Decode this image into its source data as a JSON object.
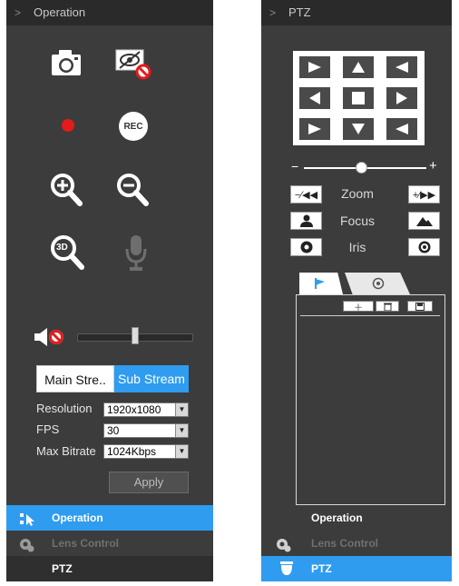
{
  "left_panel": {
    "header": "Operation",
    "icons": [
      "snapshot-camera-icon",
      "privacy-mask-off-icon",
      "record-dot-icon",
      "rec-button-icon",
      "zoom-in-icon",
      "zoom-out-icon",
      "3d-zoom-icon",
      "microphone-icon"
    ],
    "rec_label": "REC",
    "three_d_label": "3D",
    "volume_level": 0.5,
    "stream_tabs": [
      "Main Stre..",
      "Sub Stream"
    ],
    "selected_stream": "Sub Stream",
    "resolution_label": "Resolution",
    "resolution_value": "1920x1080",
    "fps_label": "FPS",
    "fps_value": "30",
    "bitrate_label": "Max Bitrate",
    "bitrate_value": "1024Kbps",
    "apply_label": "Apply",
    "nav": {
      "operation": "Operation",
      "lens": "Lens Control",
      "ptz": "PTZ"
    }
  },
  "right_panel": {
    "header": "PTZ",
    "zoom_label": "Zoom",
    "focus_label": "Focus",
    "iris_label": "Iris",
    "minus": "−",
    "plus": "+",
    "nav": {
      "operation": "Operation",
      "lens": "Lens Control",
      "ptz": "PTZ"
    }
  },
  "colors": {
    "accent": "#2f9cf0",
    "panel": "#3c3c3c",
    "header": "#2a2a2a",
    "record": "#e31b1b"
  }
}
